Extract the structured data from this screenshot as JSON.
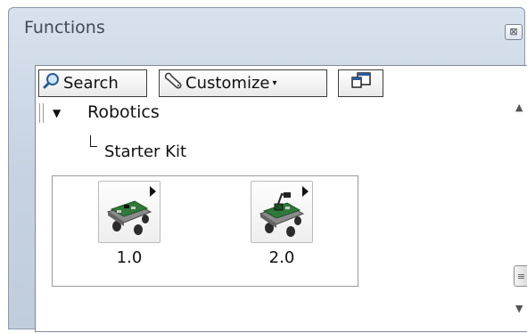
{
  "window": {
    "title": "Functions",
    "close_glyph": "⊠"
  },
  "toolbar": {
    "search_label": "Search",
    "customize_label": "Customize",
    "customize_arrow": "▾"
  },
  "tree": {
    "category": "Robotics",
    "subcategory": "Starter Kit"
  },
  "palette_items": [
    {
      "label": "1.0",
      "icon": "robot-kit-icon"
    },
    {
      "label": "2.0",
      "icon": "robot-kit-icon"
    }
  ],
  "scrollbar": {
    "up": "▲",
    "down": "▼",
    "grip": "≡"
  },
  "colors": {
    "title_bar": "#c7d3e2",
    "border": "#7d8a98",
    "content_bg": "#ffffff"
  }
}
